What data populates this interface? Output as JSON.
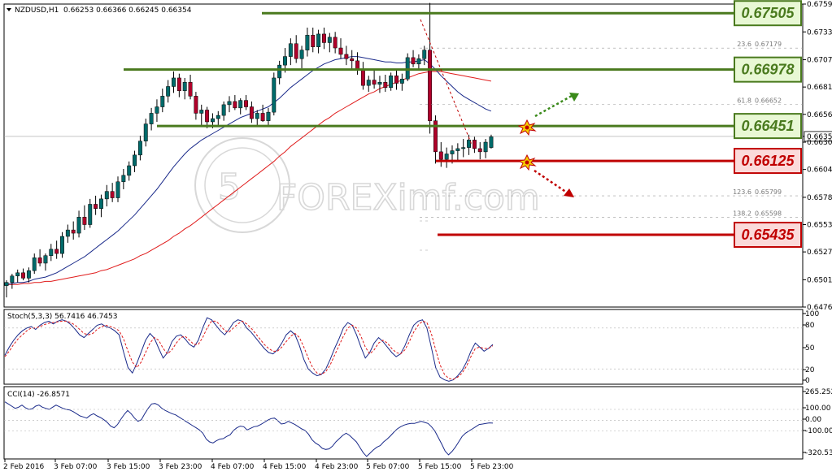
{
  "header": {
    "symbol": "NZDUSD,H1",
    "ohlc": "0.66253 0.66366 0.66245 0.66354"
  },
  "watermark": "FOREXimf.com",
  "colors": {
    "bull": "#006a6a",
    "bear": "#b0002a",
    "ma_fast": "#1a2a8a",
    "ma_slow": "#e01b1b",
    "resistance": "#4a7a1e",
    "support": "#c00000",
    "res_label_bg": "#e8f8d4",
    "sup_label_bg": "#fbdada"
  },
  "chart_data": [
    {
      "type": "candlestick",
      "name": "price",
      "ylim": [
        0.6476,
        0.6759
      ],
      "y_ticks": [
        "0.67590",
        "0.67330",
        "0.67070",
        "0.66815",
        "0.66560",
        "0.66354",
        "0.66300",
        "0.66045",
        "0.65785",
        "0.65530",
        "0.65275",
        "0.65015",
        "0.64760"
      ],
      "current_price": "0.66354",
      "x_ticks": [
        "2 Feb 2016",
        "3 Feb 07:00",
        "3 Feb 15:00",
        "3 Feb 23:00",
        "4 Feb 07:00",
        "4 Feb 15:00",
        "4 Feb 23:00",
        "5 Feb 07:00",
        "5 Feb 15:00",
        "5 Feb 23:00"
      ],
      "levels": [
        {
          "label": "0.67505",
          "value": 0.67505,
          "kind": "resistance"
        },
        {
          "label": "0.66978",
          "value": 0.66978,
          "kind": "resistance"
        },
        {
          "label": "0.66451",
          "value": 0.66451,
          "kind": "resistance"
        },
        {
          "label": "0.66125",
          "value": 0.66125,
          "kind": "support"
        },
        {
          "label": "0.65435",
          "value": 0.65435,
          "kind": "support"
        }
      ],
      "fib_levels": [
        {
          "ratio": "23.6",
          "value": "0.67179"
        },
        {
          "ratio": "61.8",
          "value": "0.66652"
        },
        {
          "ratio": "123.6",
          "value": "0.65799"
        },
        {
          "ratio": "138.2",
          "value": "0.65598"
        }
      ],
      "candles": [
        [
          0.6496,
          0.6501,
          0.6485,
          0.6499
        ],
        [
          0.6499,
          0.6507,
          0.6493,
          0.6505
        ],
        [
          0.6505,
          0.6511,
          0.6499,
          0.6508
        ],
        [
          0.6508,
          0.6512,
          0.6501,
          0.6503
        ],
        [
          0.6503,
          0.6513,
          0.6499,
          0.651
        ],
        [
          0.651,
          0.6526,
          0.6507,
          0.6522
        ],
        [
          0.6522,
          0.653,
          0.6514,
          0.6517
        ],
        [
          0.6517,
          0.6526,
          0.651,
          0.6524
        ],
        [
          0.6524,
          0.6535,
          0.6519,
          0.653
        ],
        [
          0.653,
          0.6538,
          0.6521,
          0.6526
        ],
        [
          0.6526,
          0.6546,
          0.6522,
          0.6542
        ],
        [
          0.6542,
          0.6553,
          0.6536,
          0.6548
        ],
        [
          0.6548,
          0.6556,
          0.6539,
          0.6545
        ],
        [
          0.6545,
          0.6566,
          0.6541,
          0.656
        ],
        [
          0.656,
          0.6571,
          0.6548,
          0.6553
        ],
        [
          0.6553,
          0.6577,
          0.655,
          0.6572
        ],
        [
          0.6572,
          0.658,
          0.6562,
          0.6568
        ],
        [
          0.6568,
          0.6581,
          0.656,
          0.6577
        ],
        [
          0.6577,
          0.659,
          0.657,
          0.6584
        ],
        [
          0.6584,
          0.6592,
          0.6574,
          0.6578
        ],
        [
          0.6578,
          0.6598,
          0.6574,
          0.6593
        ],
        [
          0.6593,
          0.6605,
          0.6586,
          0.6599
        ],
        [
          0.6599,
          0.6612,
          0.6594,
          0.6608
        ],
        [
          0.6608,
          0.6622,
          0.6602,
          0.6618
        ],
        [
          0.6618,
          0.6636,
          0.6613,
          0.6631
        ],
        [
          0.6631,
          0.6652,
          0.6626,
          0.6647
        ],
        [
          0.6647,
          0.6662,
          0.6641,
          0.6657
        ],
        [
          0.6657,
          0.667,
          0.6649,
          0.6663
        ],
        [
          0.6663,
          0.668,
          0.6658,
          0.6673
        ],
        [
          0.6673,
          0.6688,
          0.6667,
          0.6682
        ],
        [
          0.6682,
          0.6696,
          0.6676,
          0.669
        ],
        [
          0.669,
          0.6694,
          0.6672,
          0.6678
        ],
        [
          0.6678,
          0.669,
          0.667,
          0.6686
        ],
        [
          0.6686,
          0.6693,
          0.667,
          0.6673
        ],
        [
          0.6673,
          0.6677,
          0.6651,
          0.6657
        ],
        [
          0.6657,
          0.6665,
          0.6645,
          0.666
        ],
        [
          0.666,
          0.6663,
          0.6643,
          0.6649
        ],
        [
          0.6649,
          0.6657,
          0.6643,
          0.6652
        ],
        [
          0.6652,
          0.6659,
          0.6645,
          0.6655
        ],
        [
          0.6655,
          0.6668,
          0.665,
          0.6665
        ],
        [
          0.6665,
          0.6673,
          0.6658,
          0.6668
        ],
        [
          0.6668,
          0.6674,
          0.666,
          0.6662
        ],
        [
          0.6662,
          0.6671,
          0.6656,
          0.6669
        ],
        [
          0.6669,
          0.6674,
          0.666,
          0.6663
        ],
        [
          0.6663,
          0.6668,
          0.6648,
          0.6652
        ],
        [
          0.6652,
          0.666,
          0.6645,
          0.6657
        ],
        [
          0.6657,
          0.6665,
          0.6649,
          0.665
        ],
        [
          0.665,
          0.6662,
          0.6646,
          0.6658
        ],
        [
          0.6658,
          0.6695,
          0.6655,
          0.669
        ],
        [
          0.669,
          0.6706,
          0.6684,
          0.6702
        ],
        [
          0.6702,
          0.6718,
          0.6695,
          0.671
        ],
        [
          0.671,
          0.6727,
          0.6702,
          0.6722
        ],
        [
          0.6722,
          0.673,
          0.6704,
          0.6708
        ],
        [
          0.6708,
          0.672,
          0.6699,
          0.6716
        ],
        [
          0.6716,
          0.6737,
          0.671,
          0.673
        ],
        [
          0.673,
          0.6737,
          0.6714,
          0.6719
        ],
        [
          0.6719,
          0.6735,
          0.6713,
          0.6731
        ],
        [
          0.6731,
          0.6737,
          0.6717,
          0.6723
        ],
        [
          0.6723,
          0.6732,
          0.6714,
          0.6728
        ],
        [
          0.6728,
          0.6733,
          0.6713,
          0.6718
        ],
        [
          0.6718,
          0.6727,
          0.6708,
          0.6712
        ],
        [
          0.6712,
          0.672,
          0.6702,
          0.6708
        ],
        [
          0.6708,
          0.6716,
          0.6698,
          0.6706
        ],
        [
          0.6706,
          0.6714,
          0.6693,
          0.6697
        ],
        [
          0.6697,
          0.6705,
          0.6679,
          0.6683
        ],
        [
          0.6683,
          0.6692,
          0.6677,
          0.6688
        ],
        [
          0.6688,
          0.6697,
          0.668,
          0.6684
        ],
        [
          0.6684,
          0.6692,
          0.6676,
          0.6686
        ],
        [
          0.6686,
          0.6693,
          0.6677,
          0.6681
        ],
        [
          0.6681,
          0.6695,
          0.6678,
          0.6692
        ],
        [
          0.6692,
          0.6697,
          0.6679,
          0.6685
        ],
        [
          0.6685,
          0.6694,
          0.6678,
          0.6689
        ],
        [
          0.6689,
          0.6713,
          0.6687,
          0.6709
        ],
        [
          0.6709,
          0.6716,
          0.67,
          0.6703
        ],
        [
          0.6703,
          0.6712,
          0.6697,
          0.6708
        ],
        [
          0.6708,
          0.672,
          0.6702,
          0.6716
        ],
        [
          0.6716,
          0.676,
          0.6638,
          0.665
        ],
        [
          0.665,
          0.6655,
          0.661,
          0.6621
        ],
        [
          0.6621,
          0.663,
          0.6607,
          0.6614
        ],
        [
          0.6614,
          0.6625,
          0.6606,
          0.6619
        ],
        [
          0.6619,
          0.6627,
          0.661,
          0.6622
        ],
        [
          0.6622,
          0.6629,
          0.6613,
          0.6624
        ],
        [
          0.6624,
          0.6633,
          0.6616,
          0.6625
        ],
        [
          0.6625,
          0.6637,
          0.6618,
          0.6632
        ],
        [
          0.6632,
          0.6635,
          0.662,
          0.6624
        ],
        [
          0.6624,
          0.663,
          0.6614,
          0.6621
        ],
        [
          0.6621,
          0.6633,
          0.6615,
          0.663
        ],
        [
          0.6625,
          0.6637,
          0.6624,
          0.6635
        ]
      ],
      "ma_fast": [
        0.6497,
        0.6498,
        0.6499,
        0.6499,
        0.65,
        0.6502,
        0.6503,
        0.6504,
        0.6506,
        0.6508,
        0.6511,
        0.6514,
        0.6517,
        0.652,
        0.6523,
        0.6527,
        0.6531,
        0.6535,
        0.6539,
        0.6543,
        0.6547,
        0.6552,
        0.6557,
        0.6562,
        0.6568,
        0.6574,
        0.658,
        0.6586,
        0.6593,
        0.66,
        0.6607,
        0.6613,
        0.6619,
        0.6624,
        0.6628,
        0.6632,
        0.6635,
        0.6638,
        0.6641,
        0.6644,
        0.6647,
        0.665,
        0.6653,
        0.6655,
        0.6657,
        0.6659,
        0.6661,
        0.6663,
        0.6667,
        0.6671,
        0.6676,
        0.6681,
        0.6685,
        0.6689,
        0.6693,
        0.6697,
        0.67,
        0.6703,
        0.6705,
        0.6707,
        0.6708,
        0.6709,
        0.671,
        0.671,
        0.6709,
        0.6708,
        0.6707,
        0.6706,
        0.6705,
        0.6705,
        0.6704,
        0.6704,
        0.6705,
        0.6705,
        0.6706,
        0.6707,
        0.6703,
        0.6698,
        0.6692,
        0.6687,
        0.6682,
        0.6677,
        0.6673,
        0.667,
        0.6667,
        0.6664,
        0.6661,
        0.6659
      ],
      "ma_slow": [
        0.6497,
        0.6497,
        0.6497,
        0.6498,
        0.6498,
        0.6499,
        0.6499,
        0.65,
        0.65,
        0.6501,
        0.6502,
        0.6503,
        0.6504,
        0.6505,
        0.6506,
        0.6507,
        0.6508,
        0.651,
        0.6511,
        0.6513,
        0.6515,
        0.6517,
        0.6519,
        0.6521,
        0.6524,
        0.6526,
        0.6529,
        0.6532,
        0.6535,
        0.6538,
        0.6542,
        0.6545,
        0.6549,
        0.6552,
        0.6556,
        0.656,
        0.6564,
        0.6568,
        0.6572,
        0.6576,
        0.658,
        0.6584,
        0.6588,
        0.6592,
        0.6596,
        0.66,
        0.6604,
        0.6608,
        0.6612,
        0.6617,
        0.6621,
        0.6626,
        0.663,
        0.6634,
        0.6638,
        0.6642,
        0.6646,
        0.665,
        0.6653,
        0.6657,
        0.666,
        0.6663,
        0.6666,
        0.6669,
        0.6672,
        0.6675,
        0.6677,
        0.668,
        0.6682,
        0.6684,
        0.6686,
        0.6688,
        0.669,
        0.6692,
        0.6694,
        0.6695,
        0.6696,
        0.6696,
        0.6696,
        0.6695,
        0.6694,
        0.6693,
        0.6692,
        0.6691,
        0.669,
        0.6689,
        0.6688,
        0.6687
      ]
    },
    {
      "type": "line",
      "name": "Stoch(5,3,3)",
      "label": "Stoch(5,3,3) 56.7416 46.7453",
      "ylim": [
        0,
        100
      ],
      "y_ticks": [
        "100",
        "80",
        "50",
        "20",
        "0"
      ],
      "series": [
        {
          "values": [
            40,
            52,
            62,
            70,
            76,
            80,
            82,
            78,
            84,
            88,
            90,
            86,
            90,
            92,
            90,
            85,
            78,
            70,
            66,
            72,
            78,
            84,
            86,
            82,
            80,
            76,
            70,
            45,
            22,
            14,
            28,
            45,
            62,
            72,
            65,
            50,
            36,
            44,
            60,
            68,
            70,
            64,
            56,
            52,
            62,
            80,
            95,
            92,
            84,
            76,
            70,
            78,
            88,
            92,
            90,
            80,
            74,
            66,
            58,
            50,
            44,
            42,
            48,
            58,
            70,
            76,
            70,
            54,
            34,
            20,
            14,
            10,
            12,
            20,
            34,
            50,
            64,
            80,
            88,
            84,
            70,
            52,
            36,
            44,
            58,
            66,
            60,
            52,
            44,
            38,
            42,
            54,
            70,
            84,
            90,
            92,
            80,
            52,
            22,
            8,
            4,
            2,
            4,
            10,
            18,
            30,
            46,
            58,
            52,
            46,
            50,
            56
          ]
        },
        {
          "values": [
            38,
            46,
            56,
            64,
            70,
            76,
            80,
            80,
            82,
            85,
            87,
            88,
            89,
            90,
            90,
            88,
            84,
            78,
            72,
            70,
            72,
            78,
            82,
            84,
            82,
            80,
            76,
            64,
            46,
            30,
            22,
            30,
            44,
            58,
            66,
            62,
            50,
            42,
            48,
            58,
            66,
            68,
            62,
            56,
            56,
            66,
            80,
            90,
            90,
            84,
            76,
            74,
            80,
            86,
            90,
            86,
            80,
            72,
            64,
            56,
            50,
            46,
            46,
            52,
            60,
            68,
            72,
            66,
            52,
            36,
            22,
            14,
            12,
            16,
            26,
            40,
            54,
            68,
            80,
            84,
            80,
            68,
            52,
            42,
            48,
            58,
            62,
            58,
            50,
            44,
            42,
            48,
            60,
            74,
            84,
            90,
            88,
            72,
            48,
            26,
            12,
            6,
            5,
            8,
            14,
            24,
            38,
            50,
            52,
            50,
            50,
            54
          ]
        }
      ]
    },
    {
      "type": "line",
      "name": "CCI(14)",
      "label": "CCI(14) -26.8571",
      "ylim": [
        -320.532,
        265.252
      ],
      "y_ticks": [
        "265.252",
        "100.00",
        "0.00",
        "-100.00",
        "-320.532"
      ],
      "series": [
        {
          "values": [
            170,
            150,
            130,
            110,
            120,
            140,
            115,
            100,
            105,
            130,
            140,
            120,
            110,
            100,
            120,
            140,
            125,
            110,
            100,
            95,
            80,
            60,
            40,
            30,
            20,
            45,
            60,
            40,
            25,
            5,
            -20,
            -55,
            -70,
            -40,
            10,
            55,
            90,
            60,
            20,
            -10,
            5,
            60,
            110,
            150,
            155,
            140,
            110,
            90,
            75,
            60,
            50,
            30,
            10,
            -10,
            -30,
            -50,
            -70,
            -90,
            -120,
            -175,
            -200,
            -210,
            -190,
            -175,
            -170,
            -150,
            -135,
            -95,
            -70,
            -55,
            -60,
            -90,
            -75,
            -60,
            -55,
            -40,
            -20,
            0,
            15,
            20,
            -5,
            -35,
            -30,
            -10,
            -25,
            -40,
            -60,
            -80,
            -95,
            -130,
            -180,
            -210,
            -230,
            -260,
            -270,
            -265,
            -240,
            -200,
            -170,
            -140,
            -120,
            -140,
            -170,
            -200,
            -250,
            -300,
            -335,
            -305,
            -275,
            -250,
            -235,
            -200,
            -175,
            -145,
            -110,
            -80,
            -60,
            -45,
            -35,
            -30,
            -30,
            -20,
            -10,
            -20,
            -30,
            -60,
            -100,
            -160,
            -220,
            -285,
            -320,
            -290,
            -250,
            -200,
            -150,
            -120,
            -100,
            -80,
            -60,
            -40,
            -35,
            -30,
            -25,
            -27
          ]
        }
      ]
    }
  ]
}
